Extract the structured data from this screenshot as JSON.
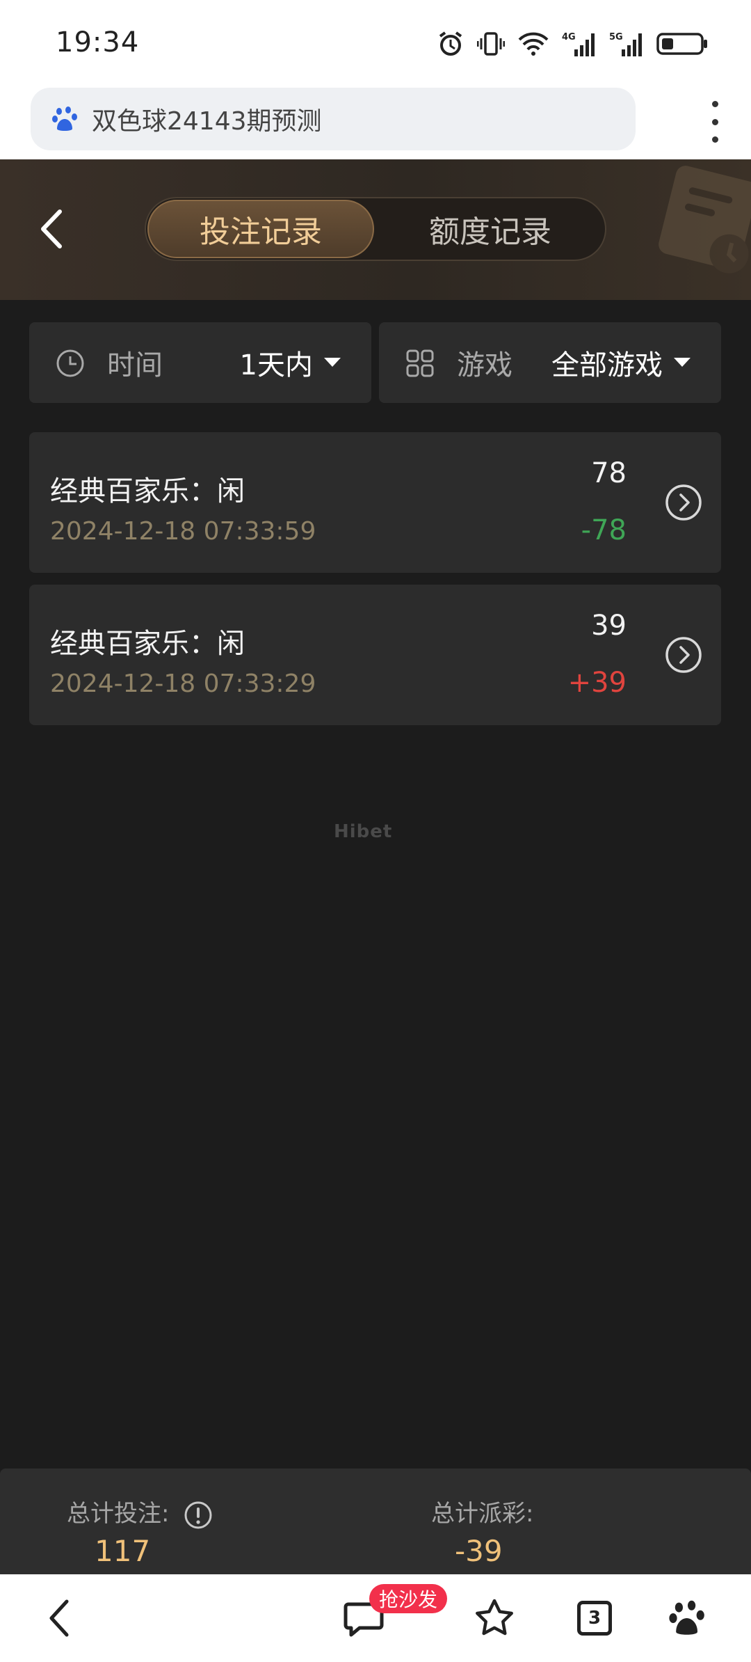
{
  "status_bar": {
    "time": "19:34"
  },
  "browser": {
    "url_title": "双色球24143期预测"
  },
  "header": {
    "tabs": [
      {
        "label": "投注记录",
        "active": true
      },
      {
        "label": "额度记录",
        "active": false
      }
    ]
  },
  "filters": {
    "time": {
      "label": "时间",
      "value": "1天内"
    },
    "game": {
      "label": "游戏",
      "value": "全部游戏"
    }
  },
  "records": [
    {
      "title": "经典百家乐：闲",
      "time": "2024-12-18 07:33:59",
      "amount": "78",
      "payout": "-78"
    },
    {
      "title": "经典百家乐：闲",
      "time": "2024-12-18 07:33:29",
      "amount": "39",
      "payout": "+39"
    }
  ],
  "watermark": "Hibet",
  "summary": {
    "total_bet_label": "总计投注:",
    "total_bet_value": "117",
    "total_payout_label": "总计派彩:",
    "total_payout_value": "-39"
  },
  "bottom_nav": {
    "sofa_badge": "抢沙发",
    "tab_count": "3"
  },
  "colors": {
    "gold": "#f1cd98",
    "win": "#e0443e",
    "loss": "#3fa656",
    "bg": "#1c1c1c"
  }
}
